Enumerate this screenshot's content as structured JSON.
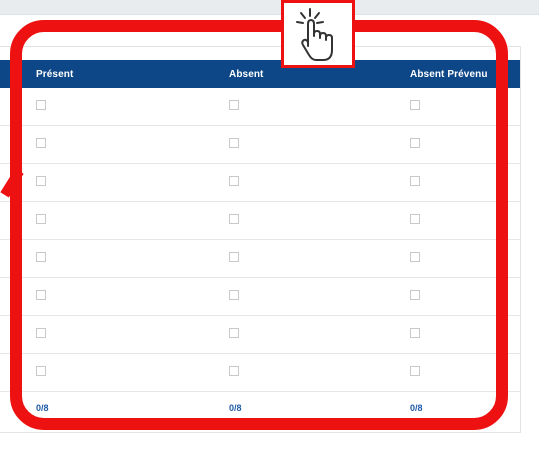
{
  "table": {
    "headers": {
      "present": "Présent",
      "absent": "Absent",
      "absent_prevenu": "Absent Prévenu"
    },
    "rows": [
      {
        "present": false,
        "absent": false,
        "absent_prevenu": false
      },
      {
        "present": false,
        "absent": false,
        "absent_prevenu": false
      },
      {
        "present": false,
        "absent": false,
        "absent_prevenu": false
      },
      {
        "present": false,
        "absent": false,
        "absent_prevenu": false
      },
      {
        "present": false,
        "absent": false,
        "absent_prevenu": false
      },
      {
        "present": false,
        "absent": false,
        "absent_prevenu": false
      },
      {
        "present": false,
        "absent": false,
        "absent_prevenu": false
      },
      {
        "present": false,
        "absent": false,
        "absent_prevenu": false
      }
    ],
    "totals": {
      "present": "0/8",
      "absent": "0/8",
      "absent_prevenu": "0/8"
    }
  },
  "annotation": {
    "icon": "hand-click-icon",
    "accent_color": "#ee1111",
    "header_color": "#0d4787"
  }
}
